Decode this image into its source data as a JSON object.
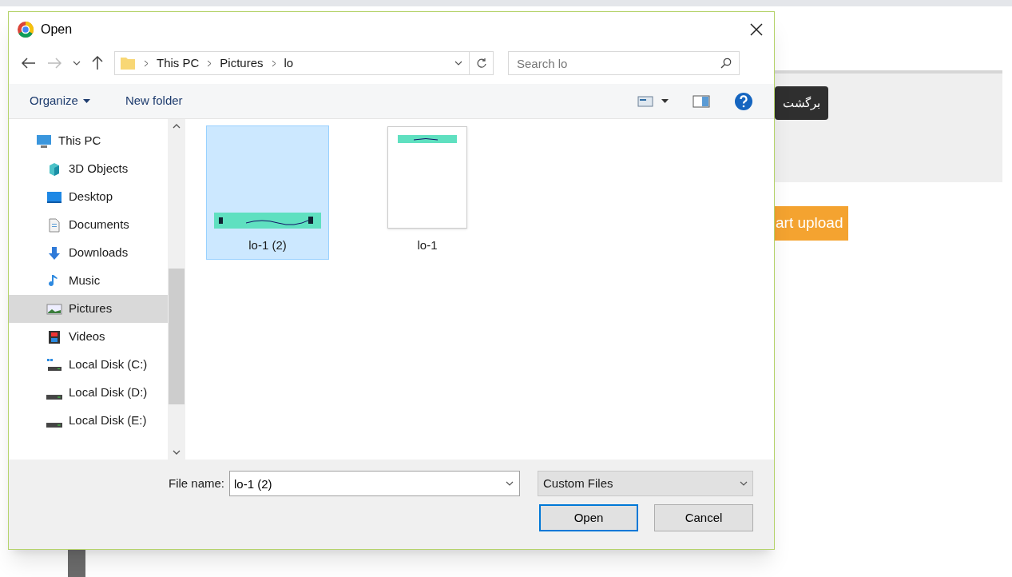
{
  "background_page": {
    "back_button": "برگشت",
    "upload_button": "art upload"
  },
  "dialog": {
    "title": "Open",
    "breadcrumbs": [
      "This PC",
      "Pictures",
      "lo"
    ],
    "search": {
      "placeholder": "Search lo"
    },
    "toolbar": {
      "organize": "Organize",
      "new_folder": "New folder"
    },
    "sidebar": {
      "items": [
        {
          "label": "This PC",
          "kind": "pc",
          "selected": false,
          "children": [
            {
              "label": "3D Objects",
              "kind": "cube",
              "selected": false
            },
            {
              "label": "Desktop",
              "kind": "desktop",
              "selected": false
            },
            {
              "label": "Documents",
              "kind": "document",
              "selected": false
            },
            {
              "label": "Downloads",
              "kind": "download",
              "selected": false
            },
            {
              "label": "Music",
              "kind": "music",
              "selected": false
            },
            {
              "label": "Pictures",
              "kind": "pictures",
              "selected": true
            },
            {
              "label": "Videos",
              "kind": "video",
              "selected": false
            },
            {
              "label": "Local Disk (C:)",
              "kind": "system-disk",
              "selected": false
            },
            {
              "label": "Local Disk (D:)",
              "kind": "disk",
              "selected": false
            },
            {
              "label": "Local Disk (E:)",
              "kind": "disk",
              "selected": false
            }
          ]
        }
      ]
    },
    "files": [
      {
        "name": "lo-1 (2)",
        "kind": "banner",
        "selected": true
      },
      {
        "name": "lo-1",
        "kind": "page",
        "selected": false
      }
    ],
    "file_name": {
      "label": "File name:",
      "value": "lo-1 (2)"
    },
    "file_type": "Custom Files",
    "buttons": {
      "open": "Open",
      "cancel": "Cancel"
    }
  }
}
